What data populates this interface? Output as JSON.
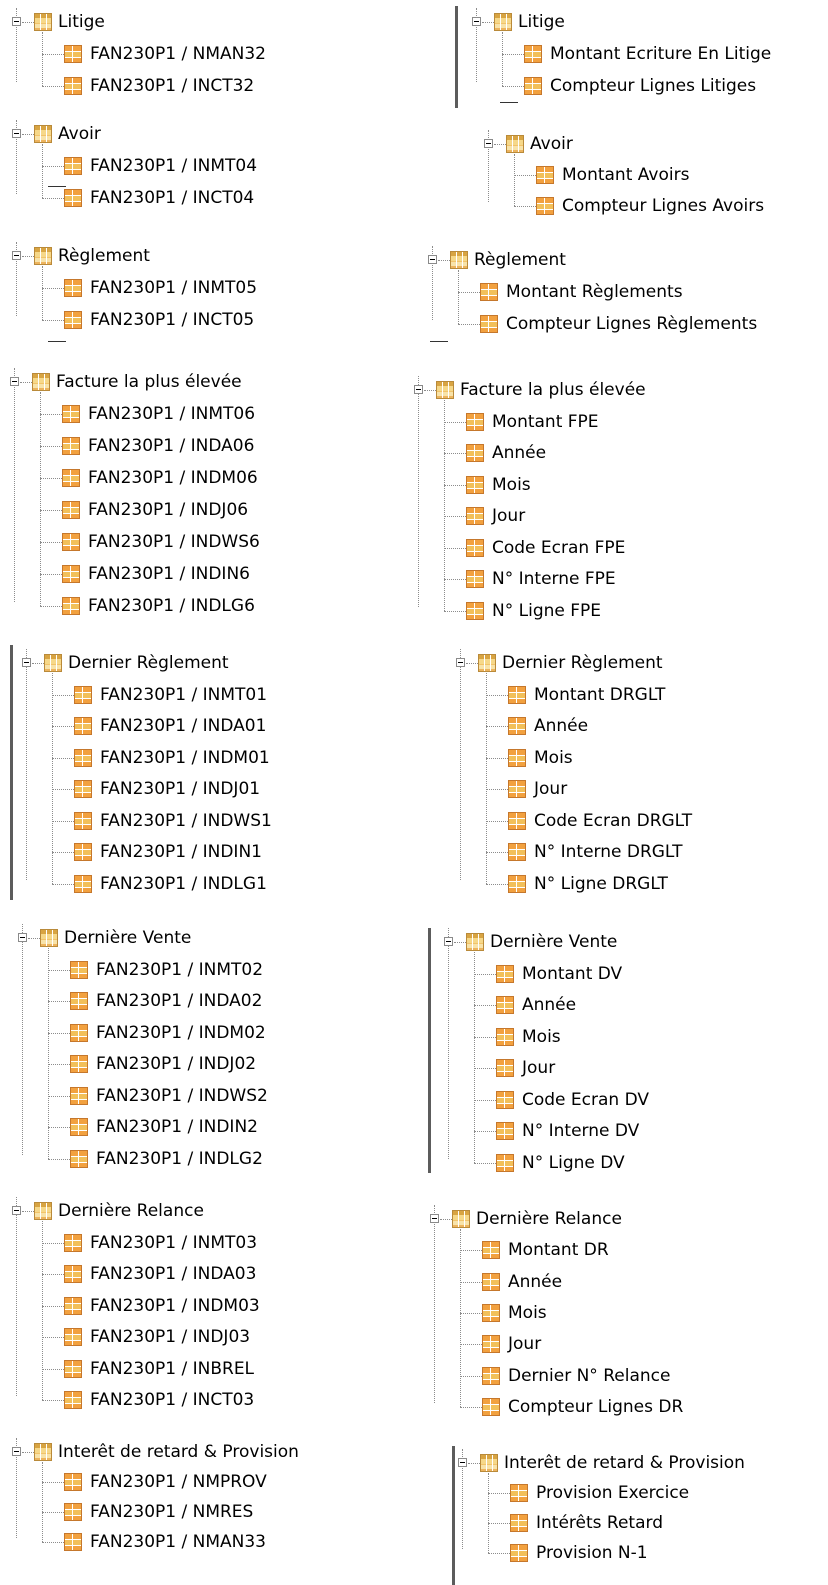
{
  "groups": [
    {
      "left": {
        "title": "Litige",
        "items": [
          "FAN230P1 / NMAN32",
          "FAN230P1 / INCT32"
        ]
      },
      "right": {
        "title": "Litige",
        "items": [
          "Montant Ecriture En Litige",
          "Compteur Lignes Litiges"
        ]
      }
    },
    {
      "left": {
        "title": "Avoir",
        "items": [
          "FAN230P1 / INMT04",
          "FAN230P1 / INCT04"
        ]
      },
      "right": {
        "title": "Avoir",
        "items": [
          "Montant Avoirs",
          "Compteur Lignes Avoirs"
        ]
      }
    },
    {
      "left": {
        "title": "Règlement",
        "items": [
          "FAN230P1 / INMT05",
          "FAN230P1 / INCT05"
        ]
      },
      "right": {
        "title": "Règlement",
        "items": [
          "Montant Règlements",
          "Compteur Lignes Règlements"
        ]
      }
    },
    {
      "left": {
        "title": "Facture la plus élevée",
        "items": [
          "FAN230P1 / INMT06",
          "FAN230P1 / INDA06",
          "FAN230P1 / INDM06",
          "FAN230P1 / INDJ06",
          "FAN230P1 / INDWS6",
          "FAN230P1 / INDIN6",
          "FAN230P1 / INDLG6"
        ]
      },
      "right": {
        "title": "Facture la plus élevée",
        "items": [
          "Montant FPE",
          "Année",
          "Mois",
          "Jour",
          "Code Ecran FPE",
          "N° Interne FPE",
          "N° Ligne FPE"
        ]
      }
    },
    {
      "left": {
        "title": "Dernier Règlement",
        "items": [
          "FAN230P1 / INMT01",
          "FAN230P1 / INDA01",
          "FAN230P1 / INDM01",
          "FAN230P1 / INDJ01",
          "FAN230P1 / INDWS1",
          "FAN230P1 / INDIN1",
          "FAN230P1 / INDLG1"
        ]
      },
      "right": {
        "title": "Dernier Règlement",
        "items": [
          "Montant DRGLT",
          "Année",
          "Mois",
          "Jour",
          "Code Ecran DRGLT",
          "N° Interne DRGLT",
          "N° Ligne DRGLT"
        ]
      }
    },
    {
      "left": {
        "title": "Dernière Vente",
        "items": [
          "FAN230P1 / INMT02",
          "FAN230P1 / INDA02",
          "FAN230P1 / INDM02",
          "FAN230P1 / INDJ02",
          "FAN230P1 / INDWS2",
          "FAN230P1 / INDIN2",
          "FAN230P1 / INDLG2"
        ]
      },
      "right": {
        "title": "Dernière Vente",
        "items": [
          "Montant DV",
          "Année",
          "Mois",
          "Jour",
          "Code Ecran DV",
          "N° Interne DV",
          "N° Ligne DV"
        ]
      }
    },
    {
      "left": {
        "title": "Dernière Relance",
        "items": [
          "FAN230P1 / INMT03",
          "FAN230P1 / INDA03",
          "FAN230P1 / INDM03",
          "FAN230P1 / INDJ03",
          "FAN230P1 / INBREL",
          "FAN230P1 / INCT03"
        ]
      },
      "right": {
        "title": "Dernière Relance",
        "items": [
          "Montant DR",
          "Année",
          "Mois",
          "Jour",
          "Dernier N° Relance",
          "Compteur Lignes DR"
        ]
      }
    },
    {
      "left": {
        "title": "Interêt de retard & Provision",
        "items": [
          "FAN230P1 / NMPROV",
          "FAN230P1 / NMRES",
          "FAN230P1 / NMAN33"
        ]
      },
      "right": {
        "title": "Interêt de retard & Provision",
        "items": [
          "Provision Exercice",
          "Intérêts Retard",
          "Provision N-1"
        ]
      }
    }
  ]
}
